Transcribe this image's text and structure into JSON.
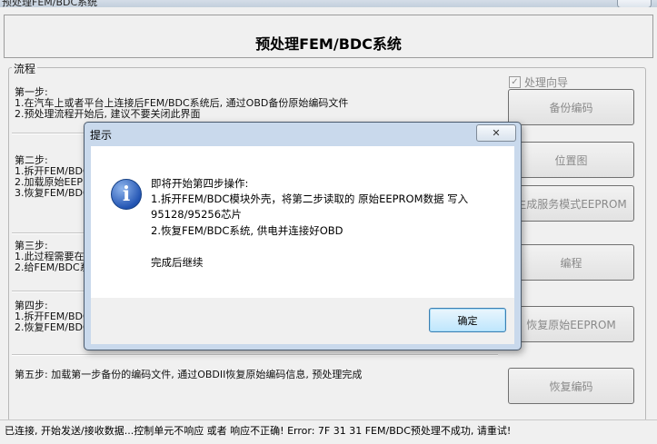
{
  "window": {
    "title": "预处理FEM/BDC系统"
  },
  "header": {
    "title": "预处理FEM/BDC系统"
  },
  "process": {
    "label": "流程",
    "wizard_checkbox": {
      "label": "处理向导",
      "checked": true
    },
    "step1": {
      "title": "第一步:",
      "line1": "1.在汽车上或者平台上连接后FEM/BDC系统后, 通过OBD备份原始编码文件",
      "line2": "2.预处理流程开始后, 建议不要关闭此界面"
    },
    "step2": {
      "title": "第二步:",
      "line1": "1.拆开FEM/BDC",
      "line2": "2.加载原始EEP",
      "line3": "3.恢复FEM/BDC"
    },
    "step3": {
      "title": "第三步:",
      "line1": "1.此过程需要在",
      "line2": "2.给FEM/BDC系"
    },
    "step4": {
      "title": "第四步:",
      "line1": "1.拆开FEM/BDC",
      "line2": "2.恢复FEM/BDC"
    },
    "step5": {
      "text": "第五步: 加载第一步备份的编码文件, 通过OBDII恢复原始编码信息, 预处理完成"
    }
  },
  "buttons": {
    "backup": "备份编码",
    "position": "位置图",
    "gen_eeprom": "生成服务模式EEPROM",
    "program": "编程",
    "restore_eeprom": "恢复原始EEPROM",
    "restore_coding": "恢复编码"
  },
  "status": {
    "text": "已连接, 开始发送/接收数据...控制单元不响应 或者 响应不正确! Error: 7F 31 31 FEM/BDC预处理不成功, 请重试!"
  },
  "dialog": {
    "title": "提示",
    "close": "✕",
    "icon": "info-icon",
    "line1": "即将开始第四步操作:",
    "line2": "1.拆开FEM/BDC模块外壳，将第二步读取的 原始EEPROM数据 写入",
    "line3": "95128/95256芯片",
    "line4": "2.恢复FEM/BDC系统, 供电并连接好OBD",
    "line5": "完成后继续",
    "ok": "确定"
  }
}
